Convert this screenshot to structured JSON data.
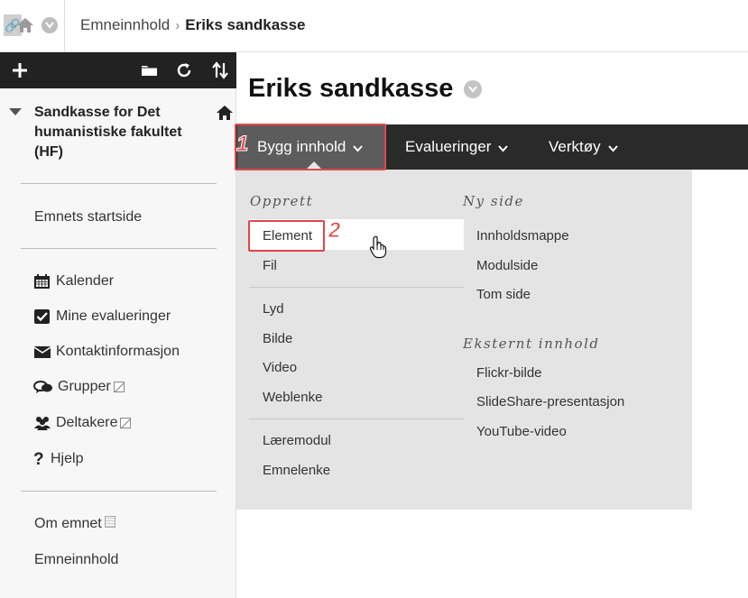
{
  "breadcrumb": {
    "parent": "Emneinnhold",
    "separator": "›",
    "current": "Eriks sandkasse"
  },
  "icons": {
    "lock": "lock-icon",
    "home": "home-icon",
    "chevron": "chevron-down-icon",
    "add": "plus-icon",
    "folder": "folder-icon",
    "refresh": "refresh-icon",
    "sort": "sort-arrows-icon",
    "cursor": "hand-pointer-icon"
  },
  "sidebar": {
    "toolbar": {
      "add": "+"
    },
    "course_title": "Sandkasse for Det humanistiske fakultet (HF)",
    "startpage": "Emnets startside",
    "tools": [
      {
        "label": "Kalender",
        "icon": "calendar-icon"
      },
      {
        "label": "Mine evalueringer",
        "icon": "checkbox-icon"
      },
      {
        "label": "Kontaktinformasjon",
        "icon": "envelope-icon"
      },
      {
        "label": "Grupper",
        "icon": "chat-icon"
      },
      {
        "label": "Deltakere",
        "icon": "users-icon"
      },
      {
        "label": "Hjelp",
        "icon": "question-icon"
      }
    ],
    "bottom": [
      {
        "label": "Om emnet"
      },
      {
        "label": "Emneinnhold"
      }
    ]
  },
  "main": {
    "title": "Eriks sandkasse"
  },
  "navbar": {
    "items": [
      {
        "label": "Bygg innhold"
      },
      {
        "label": "Evalueringer"
      },
      {
        "label": "Verktøy"
      }
    ]
  },
  "dropdown": {
    "col1_heading": "Opprett",
    "col1_group1": [
      "Element",
      "Fil"
    ],
    "col1_group2": [
      "Lyd",
      "Bilde",
      "Video",
      "Weblenke"
    ],
    "col1_group3": [
      "Læremodul",
      "Emnelenke"
    ],
    "col2_heading": "Ny side",
    "col2_items": [
      "Innholdsmappe",
      "Modulside",
      "Tom side"
    ],
    "col3_heading": "Eksternt innhold",
    "col3_items": [
      "Flickr-bilde",
      "SlideShare-presentasjon",
      "YouTube-video"
    ]
  },
  "callouts": {
    "step1": "1",
    "step2": "2"
  },
  "colors": {
    "navbar": "#2a2a2a",
    "nav_active": "#5c5c5c",
    "dropdown_bg": "#e4e4e4",
    "callout": "#e0474c"
  }
}
